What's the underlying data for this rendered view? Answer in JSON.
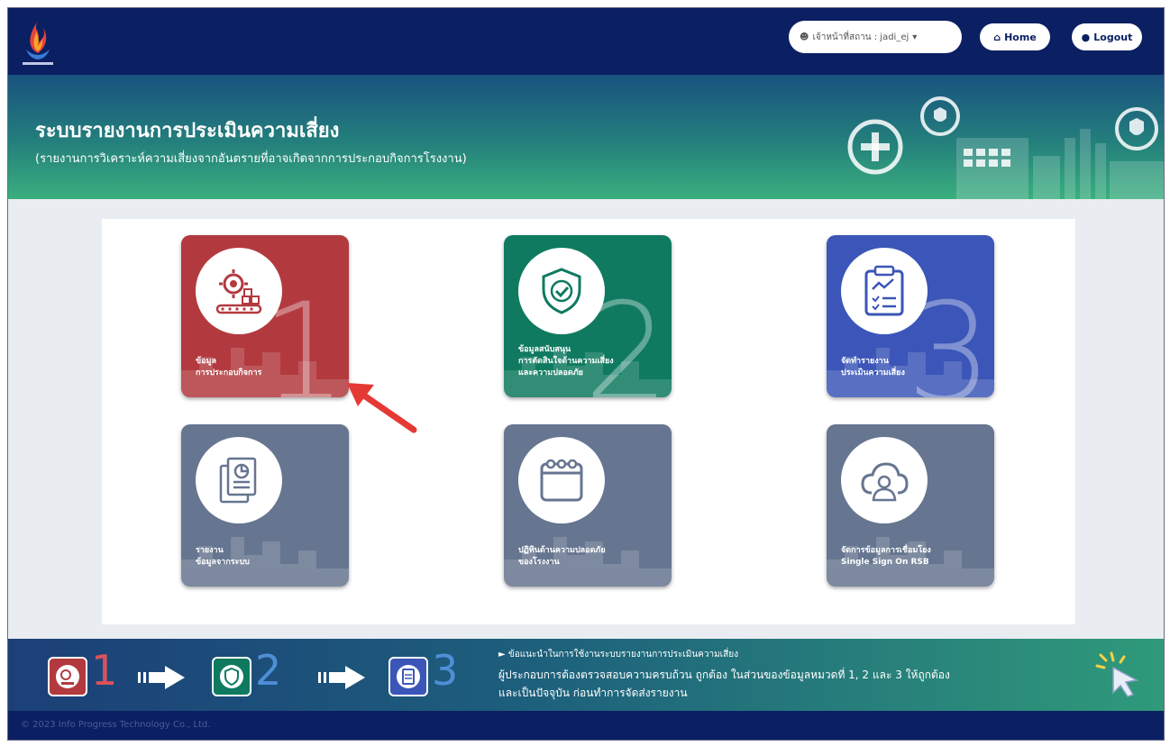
{
  "header": {
    "user_label": "เจ้าหน้าที่สถาน : jadi_ej",
    "home_label": "Home",
    "logout_label": "Logout"
  },
  "banner": {
    "title": "ระบบรายงานการประเมินความเสี่ยง",
    "subtitle": "(รายงานการวิเคราะห์ความเสี่ยงจากอันตรายที่อาจเกิดจากการประกอบกิจการโรงงาน)"
  },
  "cards": [
    {
      "number": "1",
      "line1": "ข้อมูล",
      "line2": "การประกอบกิจการ",
      "line3": "",
      "color": "#b23a3f"
    },
    {
      "number": "2",
      "line1": "ข้อมูลสนับสนุน",
      "line2": "การตัดสินใจด้านความเสี่ยง",
      "line3": "และความปลอดภัย",
      "color": "#0f7a60"
    },
    {
      "number": "3",
      "line1": "จัดทำรายงาน",
      "line2": "ประเมินความเสี่ยง",
      "line3": "",
      "color": "#3b56b8"
    },
    {
      "number": "",
      "line1": "รายงาน",
      "line2": "ข้อมูลจากระบบ",
      "line3": "",
      "color": "#667590"
    },
    {
      "number": "",
      "line1": "ปฏิทินด้านความปลอดภัย",
      "line2": "ของโรงงาน",
      "line3": "",
      "color": "#667590"
    },
    {
      "number": "",
      "line1": "จัดการข้อมูลการเชื่อมโยง",
      "line2": "Single Sign On RSB",
      "line3": "",
      "color": "#667590"
    }
  ],
  "steps": {
    "n1": "1",
    "n2": "2",
    "n3": "3",
    "tip_heading": "► ข้อแนะนำในการใช้งานระบบรายงานการประเมินความเสี่ยง",
    "tip_line1": "ผู้ประกอบการต้องตรวจสอบความครบถ้วน ถูกต้อง ในส่วนของข้อมูลหมวดที่ 1, 2 และ 3 ให้ถูกต้อง",
    "tip_line2": "และเป็นปัจจุบัน ก่อนทำการจัดส่งรายงาน"
  },
  "footer": {
    "copyright": "© 2023 Info Progress Technology Co., Ltd."
  },
  "colors": {
    "navy": "#0b1f63",
    "red": "#b23a3f",
    "green": "#0f7a60",
    "blue": "#3b56b8",
    "gray": "#667590"
  },
  "icons": [
    "logo-icon",
    "user-icon",
    "home-icon",
    "power-icon",
    "gear-conveyor-icon",
    "shield-check-icon",
    "clipboard-chart-icon",
    "documents-chart-icon",
    "calendar-icon",
    "cloud-user-icon",
    "arrow-pointer-icon",
    "cursor-sparkle-icon"
  ]
}
